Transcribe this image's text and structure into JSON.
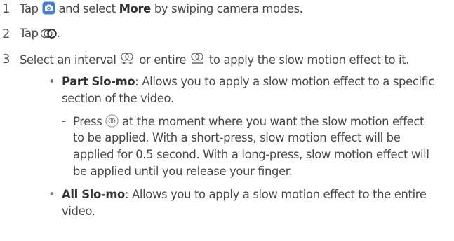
{
  "steps": [
    {
      "number": "1",
      "pre": "Tap",
      "icon": "camera-app-icon",
      "mid": "and select",
      "bold": "More",
      "post": "by swiping camera modes."
    },
    {
      "number": "2",
      "pre": "Tap",
      "icon": "slow-motion-mode-icon",
      "post": "."
    },
    {
      "number": "3",
      "pre": "Select an interval",
      "icon_a": "part-slo-mo-icon",
      "mid": "or entire",
      "icon_b": "all-slo-mo-icon",
      "post": "to apply the slow motion effect to it."
    }
  ],
  "bullets": [
    {
      "term": "Part Slo-mo",
      "desc_line1": ": Allows you to apply a slow motion effect to a specific",
      "desc_line2": "section of the video.",
      "sub": {
        "pre": "Press",
        "icon": "slow-motion-button-icon",
        "line1_post": "at the moment where you want the slow motion effect",
        "line2": "to be applied. With a short-press, slow motion effect will be",
        "line3": "applied for 0.5 second. With a long-press, slow motion effect will",
        "line4": "be applied until you release your finger."
      }
    },
    {
      "term": "All Slo-mo",
      "desc_line1": ": Allows you to apply a slow motion effect to the entire",
      "desc_line2": "video."
    }
  ],
  "colors": {
    "text": "#4a4a4a",
    "camera_icon_bg": "#3f7fce"
  }
}
